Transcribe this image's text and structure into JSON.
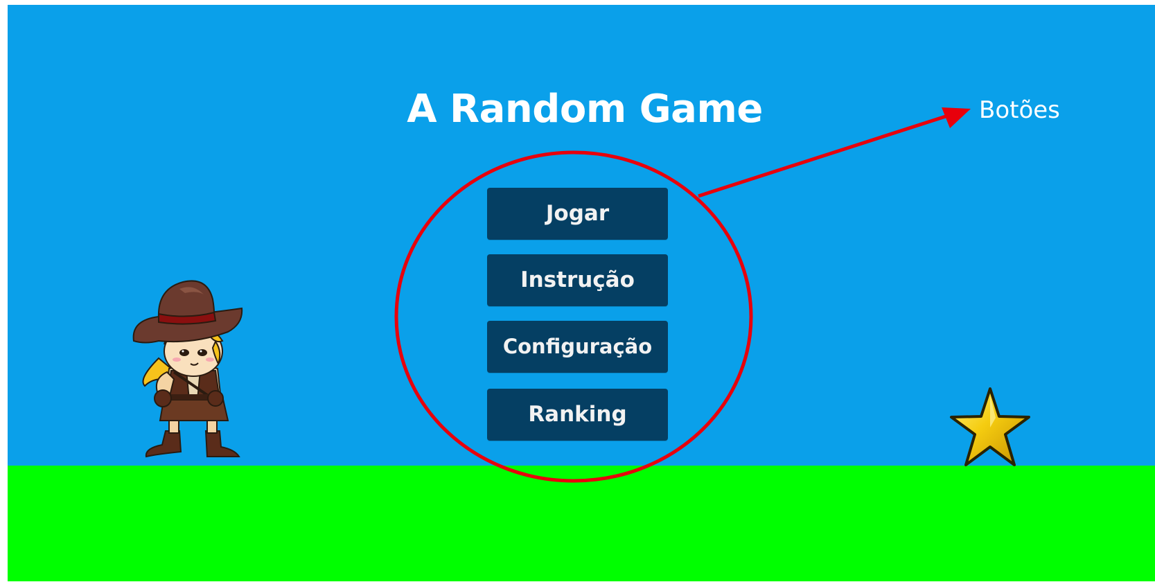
{
  "game": {
    "title": "A Random Game",
    "sky_color": "#0aa0ea",
    "ground_color": "#00ff00"
  },
  "menu": {
    "button_color": "#053f63",
    "button_text_color": "#f2f2f2",
    "buttons": [
      {
        "label": "Jogar"
      },
      {
        "label": "Instrução"
      },
      {
        "label": "Configuração"
      },
      {
        "label": "Ranking"
      }
    ]
  },
  "annotation": {
    "label": "Botões",
    "color": "#e8000b"
  },
  "sprites": {
    "player": "cowgirl-character",
    "collectible": "gold-star-icon"
  }
}
